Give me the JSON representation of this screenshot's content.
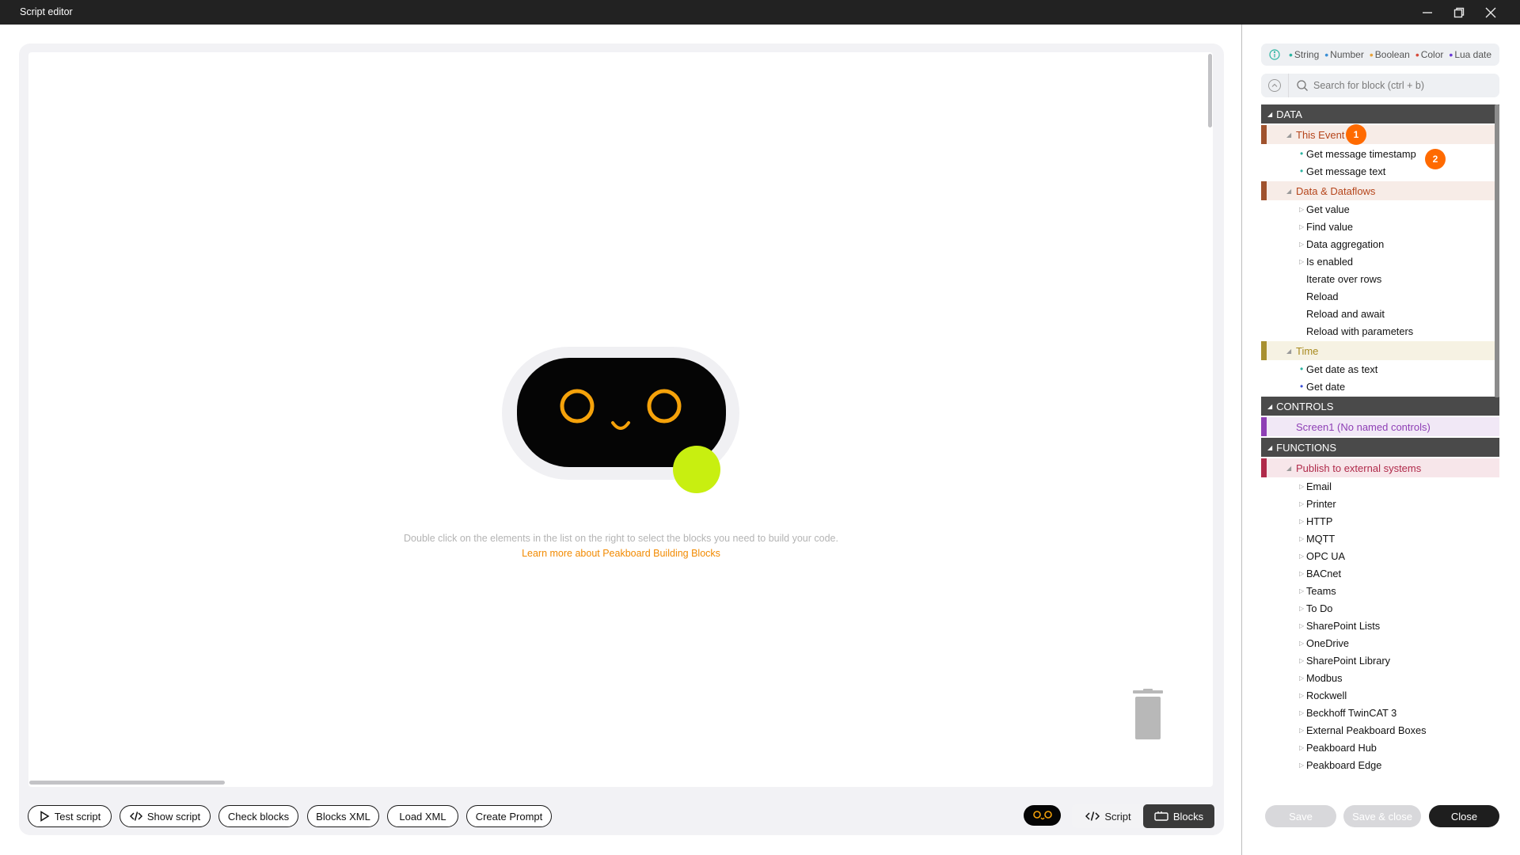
{
  "window": {
    "title": "Script editor"
  },
  "canvas": {
    "hint": "Double click on the elements in the list on the right to select the blocks you need to build your code.",
    "learn_more": "Learn more about Peakboard Building Blocks"
  },
  "toolbar": {
    "test_script": "Test script",
    "show_script": "Show script",
    "check_blocks": "Check blocks",
    "blocks_xml": "Blocks XML",
    "load_xml": "Load XML",
    "create_prompt": "Create Prompt",
    "view_script": "Script",
    "view_blocks": "Blocks",
    "active_view": "Blocks"
  },
  "legend": {
    "items": [
      {
        "label": "String",
        "color": "#2bb3a0"
      },
      {
        "label": "Number",
        "color": "#3a8fd6"
      },
      {
        "label": "Boolean",
        "color": "#e8a33c"
      },
      {
        "label": "Color",
        "color": "#d64a3a"
      },
      {
        "label": "Lua date",
        "color": "#6a3ad6"
      }
    ]
  },
  "search": {
    "placeholder": "Search for block (ctrl + b)"
  },
  "tree": {
    "data": {
      "header": "DATA",
      "this_event": {
        "label": "This Event",
        "badge": "1",
        "items": [
          {
            "label": "Get message timestamp",
            "bullet_color": "#2bb3a0"
          },
          {
            "label": "Get message text",
            "bullet_color": "#2bb3a0"
          }
        ],
        "badge2": "2"
      },
      "dataflows": {
        "label": "Data & Dataflows",
        "items": [
          {
            "label": "Get value",
            "expandable": true
          },
          {
            "label": "Find value",
            "expandable": true
          },
          {
            "label": "Data aggregation",
            "expandable": true
          },
          {
            "label": "Is enabled",
            "expandable": true
          },
          {
            "label": "Iterate over rows",
            "expandable": false
          },
          {
            "label": "Reload",
            "expandable": false
          },
          {
            "label": "Reload and await",
            "expandable": false
          },
          {
            "label": "Reload with parameters",
            "expandable": false
          }
        ]
      },
      "time": {
        "label": "Time",
        "items": [
          {
            "label": "Get date as text",
            "bullet_color": "#2bb3a0"
          },
          {
            "label": "Get date",
            "bullet_color": "#3a4fd6"
          }
        ]
      }
    },
    "controls": {
      "header": "CONTROLS",
      "screen": "Screen1 (No named controls)"
    },
    "functions": {
      "header": "FUNCTIONS",
      "publish": {
        "label": "Publish to external systems",
        "items": [
          "Email",
          "Printer",
          "HTTP",
          "MQTT",
          "OPC UA",
          "BACnet",
          "Teams",
          "To Do",
          "SharePoint Lists",
          "OneDrive",
          "SharePoint Library",
          "Modbus",
          "Rockwell",
          "Beckhoff TwinCAT 3",
          "External Peakboard Boxes",
          "Peakboard Hub",
          "Peakboard Edge"
        ]
      }
    }
  },
  "footer": {
    "save": "Save",
    "save_close": "Save & close",
    "close": "Close"
  },
  "colors": {
    "accent_orange": "#ff6a00",
    "link_orange": "#f28a00",
    "mascot_dot": "#c8ef10",
    "data_bar": "#a0522d",
    "time_bar": "#a89030",
    "controls_bar": "#8e3fb5",
    "functions_bar": "#b02a4a"
  }
}
